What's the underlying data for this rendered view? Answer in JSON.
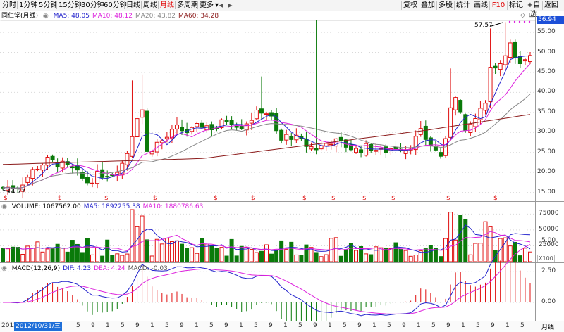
{
  "toolbar": {
    "left_tabs": [
      "分时",
      "1分钟",
      "5分钟",
      "15分钟",
      "30分钟",
      "60分钟",
      "日线",
      "周线",
      "月线",
      "多周期",
      "更多"
    ],
    "active_tab": "月线",
    "more_arrow": "▾",
    "right_buttons": [
      "复权",
      "叠加",
      "多股",
      "统计",
      "画线",
      "F10",
      "标记",
      "+自选",
      "返回"
    ]
  },
  "stock": {
    "title": "同仁堂(月线)",
    "ma_legend": [
      {
        "label": "MA5: 48.05",
        "color": "#2222cc"
      },
      {
        "label": "MA10: 48.12",
        "color": "#dd22dd"
      },
      {
        "label": "MA20: 43.82",
        "color": "#888888"
      },
      {
        "label": "MA60: 34.28",
        "color": "#8b1a1a"
      }
    ],
    "high_label": "57.57",
    "low_label": "14.77",
    "current_price": "56.94",
    "price_axis": [
      "55.00",
      "50.00",
      "45.00",
      "40.00",
      "35.00",
      "30.00",
      "25.00",
      "20.00",
      "15.00"
    ]
  },
  "volume": {
    "legend": [
      {
        "label": "VOLUME: 1067562.00",
        "color": "#000000"
      },
      {
        "label": "MA5: 1892255.38",
        "color": "#2222cc"
      },
      {
        "label": "MA10: 1880786.63",
        "color": "#dd22dd"
      }
    ],
    "axis": [
      "75000",
      "50000",
      "25000"
    ],
    "unit": "X100"
  },
  "macd": {
    "legend": [
      {
        "label": "MACD(12,26,9)",
        "color": "#000000"
      },
      {
        "label": "DIF: 4.23",
        "color": "#2222cc"
      },
      {
        "label": "DEA: 4.24",
        "color": "#dd22dd"
      },
      {
        "label": "MACD: -0.03",
        "color": "#555555"
      }
    ],
    "axis": [
      "5.00",
      "2.50",
      "0.00"
    ]
  },
  "datebar": {
    "left_label": "2012",
    "current_date": "2012/10/31/三",
    "period_label": "月线",
    "ticks": [
      "5",
      "9",
      "1",
      "5",
      "9",
      "1",
      "5",
      "9",
      "1",
      "5",
      "9",
      "1",
      "5",
      "9",
      "1",
      "5",
      "9",
      "1",
      "5",
      "9",
      "1",
      "5",
      "9",
      "1",
      "5",
      "9",
      "1",
      "5",
      "9",
      "1",
      "5",
      "9",
      "1",
      "5",
      "9",
      "1"
    ]
  },
  "colors": {
    "up": "#e01010",
    "down": "#0a7a0a",
    "ma5": "#2222cc",
    "ma10": "#dd22dd",
    "ma20": "#888888",
    "ma60": "#8b1a1a"
  }
}
